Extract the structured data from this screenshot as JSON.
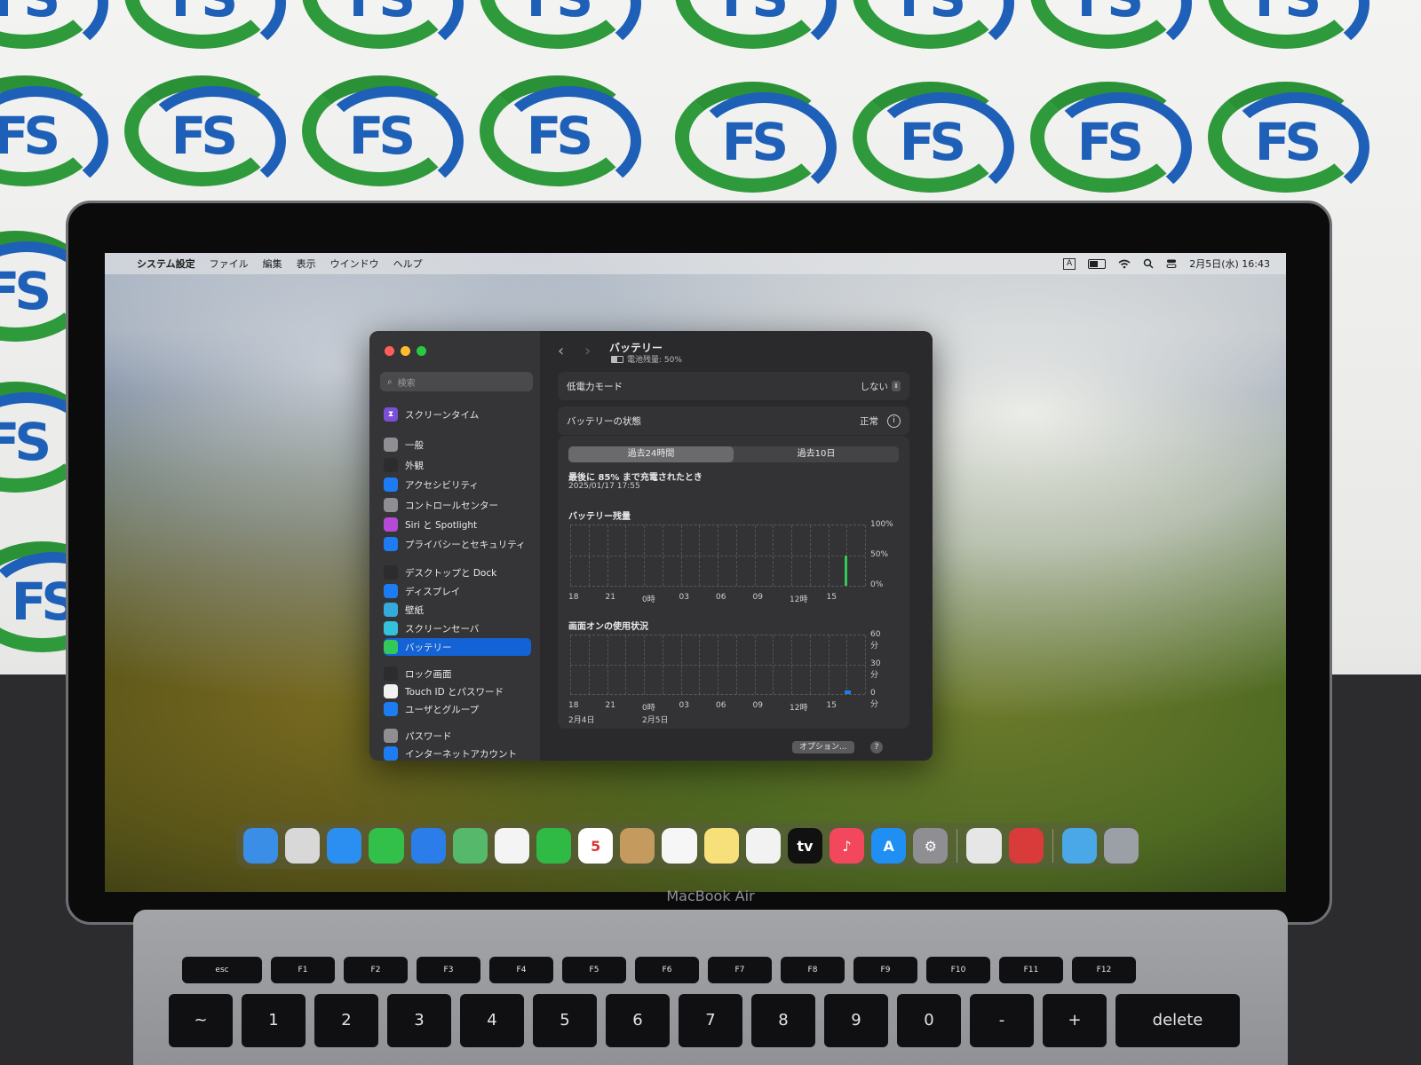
{
  "menubar": {
    "apple": "",
    "app": "システム設定",
    "items": [
      "ファイル",
      "編集",
      "表示",
      "ウインドウ",
      "ヘルプ"
    ],
    "input_badge": "A",
    "datetime": "2月5日(水) 16:43"
  },
  "search": {
    "placeholder": "検索"
  },
  "sidebar": {
    "screen_time": "スクリーンタイム",
    "items": [
      {
        "label": "一般",
        "icon": "gear-icon",
        "color": "#8e8e93"
      },
      {
        "label": "外観",
        "icon": "appearance-icon",
        "color": "#2c2c2e"
      },
      {
        "label": "アクセシビリティ",
        "icon": "accessibility-icon",
        "color": "#1d7cf2"
      },
      {
        "label": "コントロールセンター",
        "icon": "control-center-icon",
        "color": "#8e8e93"
      },
      {
        "label": "Siri と Spotlight",
        "icon": "siri-icon",
        "color": "#b54ad6"
      },
      {
        "label": "プライバシーとセキュリティ",
        "icon": "hand-icon",
        "color": "#1d7cf2"
      },
      {
        "label": "デスクトップと Dock",
        "icon": "dock-icon",
        "color": "#2c2c2e"
      },
      {
        "label": "ディスプレイ",
        "icon": "display-icon",
        "color": "#1d7cf2"
      },
      {
        "label": "壁紙",
        "icon": "wallpaper-icon",
        "color": "#35aadc"
      },
      {
        "label": "スクリーンセーバ",
        "icon": "screensaver-icon",
        "color": "#35c0dc"
      },
      {
        "label": "バッテリー",
        "icon": "battery-icon",
        "color": "#34c759"
      },
      {
        "label": "ロック画面",
        "icon": "lock-icon",
        "color": "#2c2c2e"
      },
      {
        "label": "Touch ID とパスワード",
        "icon": "fingerprint-icon",
        "color": "#f2f2f2"
      },
      {
        "label": "ユーザとグループ",
        "icon": "users-icon",
        "color": "#1d7cf2"
      },
      {
        "label": "パスワード",
        "icon": "key-icon",
        "color": "#8e8e93"
      },
      {
        "label": "インターネットアカウント",
        "icon": "at-icon",
        "color": "#1d7cf2"
      }
    ]
  },
  "content": {
    "title": "バッテリー",
    "subtitle": "電池残量: 50%",
    "low_power_label": "低電力モード",
    "low_power_value": "しない",
    "health_label": "バッテリーの状態",
    "health_value": "正常",
    "tab_24h": "過去24時間",
    "tab_10d": "過去10日",
    "last_charge_label": "最後に 85% まで充電されたとき",
    "last_charge_date": "2025/01/17 17:55",
    "battery_level_label": "バッテリー残量",
    "screen_usage_label": "画面オンの使用状況",
    "options_button": "オプション...",
    "help_button": "?"
  },
  "chart_data": [
    {
      "type": "bar",
      "title": "バッテリー残量",
      "categories": [
        "18",
        "21",
        "0時",
        "03",
        "06",
        "09",
        "12時",
        "15"
      ],
      "ytick_labels": [
        "100%",
        "50%",
        "0%"
      ],
      "ylim": [
        0,
        100
      ],
      "series": [
        {
          "values": [
            0,
            0,
            0,
            0,
            0,
            0,
            0,
            50
          ],
          "color": "#34c759"
        }
      ]
    },
    {
      "type": "bar",
      "title": "画面オンの使用状況",
      "categories": [
        "18",
        "21",
        "0時",
        "03",
        "06",
        "09",
        "12時",
        "15"
      ],
      "date_labels": [
        "2月4日",
        "",
        "2月5日",
        "",
        "",
        "",
        "",
        ""
      ],
      "ytick_labels": [
        "60分",
        "30分",
        "0分"
      ],
      "ylim": [
        0,
        60
      ],
      "series": [
        {
          "values": [
            0,
            0,
            0,
            0,
            0,
            0,
            0,
            4
          ],
          "color": "#1d7cf2"
        }
      ]
    }
  ],
  "dock": {
    "apps": [
      {
        "name": "finder-icon",
        "color": "#3a8ee6",
        "glyph": ""
      },
      {
        "name": "launchpad-icon",
        "color": "#d8d8d8",
        "glyph": ""
      },
      {
        "name": "safari-icon",
        "color": "#2a8ff0",
        "glyph": ""
      },
      {
        "name": "messages-icon",
        "color": "#33c04a",
        "glyph": ""
      },
      {
        "name": "mail-icon",
        "color": "#2b7de9",
        "glyph": ""
      },
      {
        "name": "maps-icon",
        "color": "#55b86a",
        "glyph": ""
      },
      {
        "name": "photos-icon",
        "color": "#f4f4f4",
        "glyph": ""
      },
      {
        "name": "facetime-icon",
        "color": "#2fba46",
        "glyph": ""
      },
      {
        "name": "calendar-icon",
        "color": "#ffffff",
        "glyph": "5"
      },
      {
        "name": "contacts-icon",
        "color": "#c59a5e",
        "glyph": ""
      },
      {
        "name": "reminders-icon",
        "color": "#f6f6f6",
        "glyph": ""
      },
      {
        "name": "notes-icon",
        "color": "#f7e07a",
        "glyph": ""
      },
      {
        "name": "freeform-icon",
        "color": "#f2f2f2",
        "glyph": ""
      },
      {
        "name": "appletv-icon",
        "color": "#111111",
        "glyph": "tv"
      },
      {
        "name": "music-icon",
        "color": "#f2475c",
        "glyph": "♪"
      },
      {
        "name": "appstore-icon",
        "color": "#1f8ff3",
        "glyph": "A"
      },
      {
        "name": "settings-icon",
        "color": "#8e8e93",
        "glyph": "⚙"
      },
      {
        "name": "preview-icon",
        "color": "#e6e6e6",
        "glyph": ""
      },
      {
        "name": "photo-booth-icon",
        "color": "#d93a3a",
        "glyph": ""
      },
      {
        "name": "downloads-folder-icon",
        "color": "#4aa8e8",
        "glyph": ""
      },
      {
        "name": "trash-icon",
        "color": "#9aa0a6",
        "glyph": ""
      }
    ]
  },
  "laptop": {
    "brand": "MacBook Air"
  },
  "keyboard": {
    "function_row": [
      "esc",
      "F1",
      "F2",
      "F3",
      "F4",
      "F5",
      "F6",
      "F7",
      "F8",
      "F9",
      "F10",
      "F11",
      "F12"
    ],
    "number_row": [
      "~",
      "1",
      "2",
      "3",
      "4",
      "5",
      "6",
      "7",
      "8",
      "9",
      "0",
      "-",
      "+",
      "delete"
    ]
  }
}
